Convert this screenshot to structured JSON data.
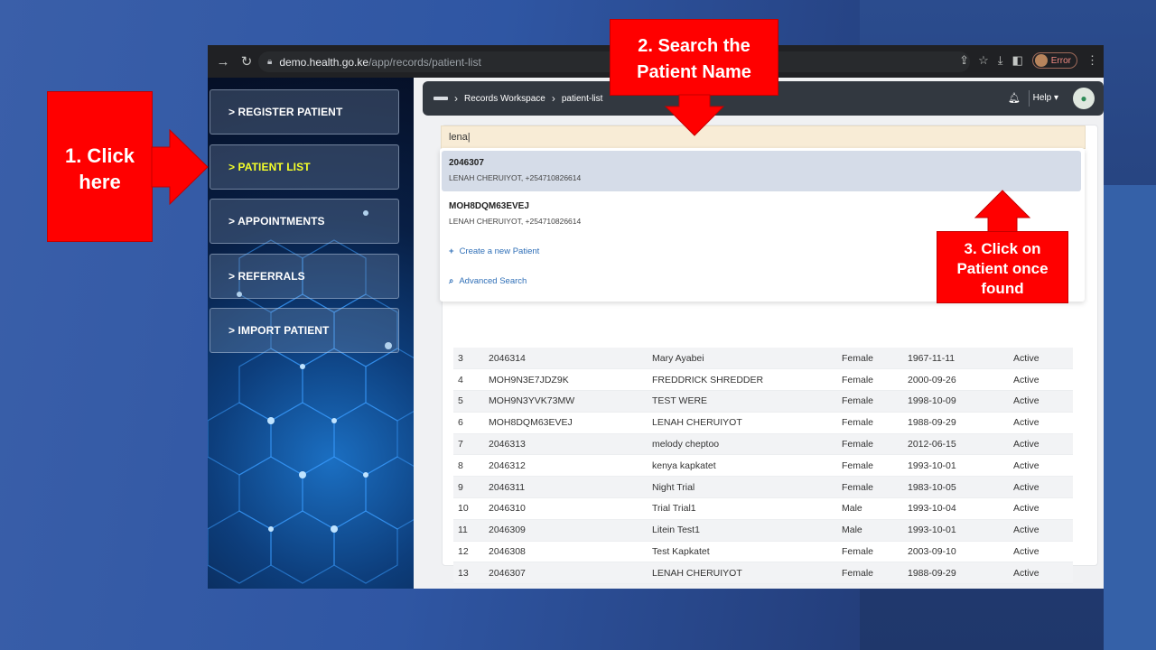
{
  "browser": {
    "url_host": "demo.health.go.ke",
    "url_path": "/app/records/patient-list",
    "profile_status": "Error"
  },
  "sidebar": {
    "items": [
      {
        "label": "> REGISTER PATIENT"
      },
      {
        "label": "> PATIENT LIST"
      },
      {
        "label": "> APPOINTMENTS"
      },
      {
        "label": "> REFERRALS"
      },
      {
        "label": "> IMPORT PATIENT"
      }
    ],
    "active": "> PATIENT LIST"
  },
  "topbar": {
    "breadcrumb": [
      "Records Workspace",
      "patient-list"
    ],
    "help_label": "Help"
  },
  "search": {
    "value": "lena"
  },
  "suggestions": [
    {
      "id": "2046307",
      "detail": "LENAH CHERUIYOT, +254710826614"
    },
    {
      "id": "MOH8DQM63EVEJ",
      "detail": "LENAH CHERUIYOT, +254710826614"
    }
  ],
  "dropdown_links": {
    "create": "Create a new Patient",
    "advanced": "Advanced Search"
  },
  "patients": [
    [
      "3",
      "2046314",
      "Mary Ayabei",
      "Female",
      "1967-11-11",
      "Active"
    ],
    [
      "4",
      "MOH9N3E7JDZ9K",
      "FREDDRICK SHREDDER",
      "Female",
      "2000-09-26",
      "Active"
    ],
    [
      "5",
      "MOH9N3YVK73MW",
      "TEST WERE",
      "Female",
      "1998-10-09",
      "Active"
    ],
    [
      "6",
      "MOH8DQM63EVEJ",
      "LENAH CHERUIYOT",
      "Female",
      "1988-09-29",
      "Active"
    ],
    [
      "7",
      "2046313",
      "melody cheptoo",
      "Female",
      "2012-06-15",
      "Active"
    ],
    [
      "8",
      "2046312",
      "kenya kapkatet",
      "Female",
      "1993-10-01",
      "Active"
    ],
    [
      "9",
      "2046311",
      "Night Trial",
      "Female",
      "1983-10-05",
      "Active"
    ],
    [
      "10",
      "2046310",
      "Trial Trial1",
      "Male",
      "1993-10-04",
      "Active"
    ],
    [
      "11",
      "2046309",
      "Litein Test1",
      "Male",
      "1993-10-01",
      "Active"
    ],
    [
      "12",
      "2046308",
      "Test Kapkatet",
      "Female",
      "2003-09-10",
      "Active"
    ],
    [
      "13",
      "2046307",
      "LENAH CHERUIYOT",
      "Female",
      "1988-09-29",
      "Active"
    ]
  ],
  "annotations": {
    "step1": [
      "1.  Click",
      "here"
    ],
    "step2": [
      "2. Search the",
      "Patient Name"
    ],
    "step3": [
      "3. Click on",
      "Patient once",
      "found"
    ]
  },
  "colors": {
    "annotation_red": "#ff0000",
    "active_menu": "#f5ff2a",
    "search_bg": "#f8ecd6",
    "highlight_row": "#d5dce8"
  }
}
